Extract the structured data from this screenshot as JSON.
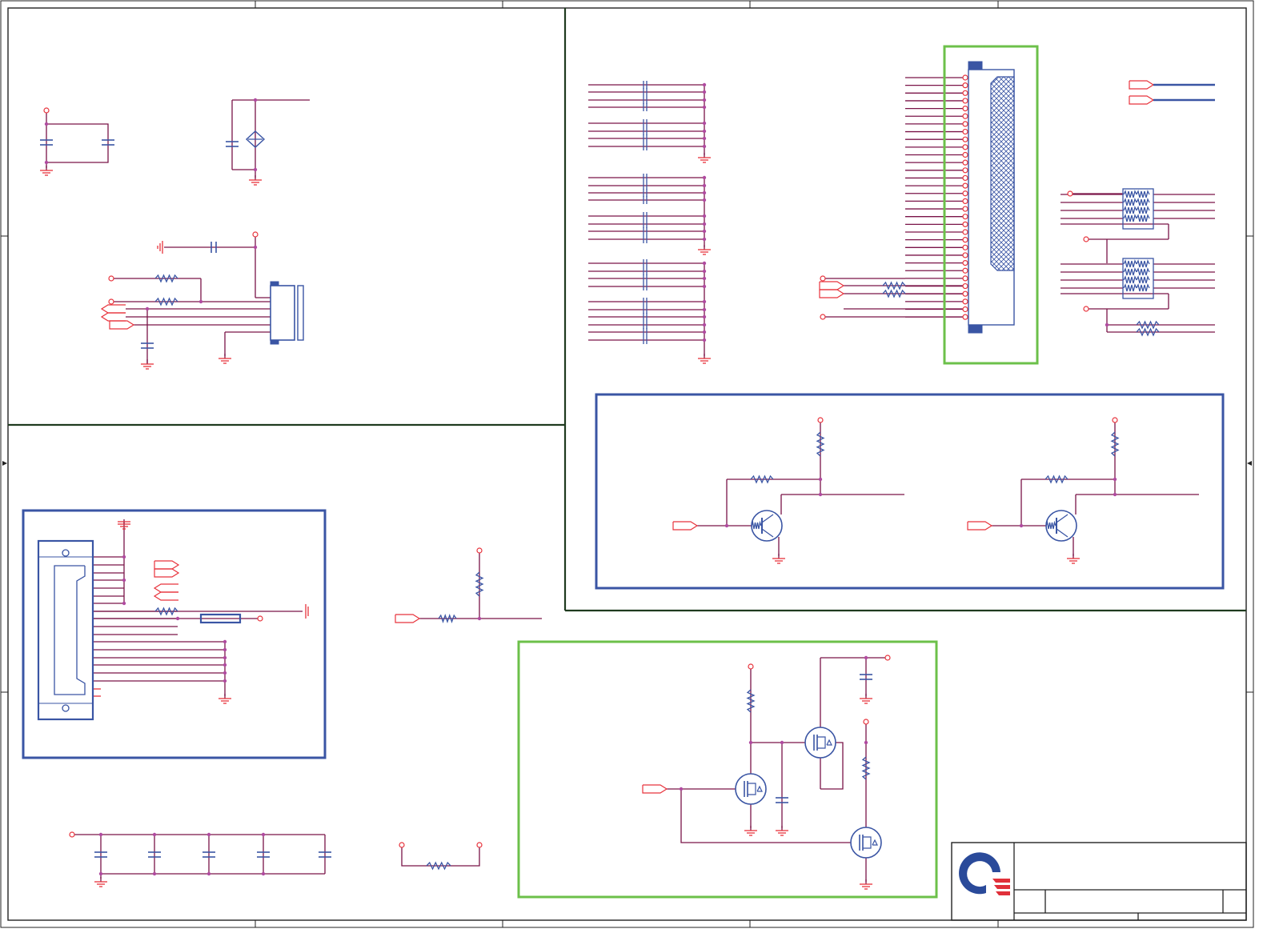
{
  "colors": {
    "wire": "#7a1448",
    "pin": "#e8333c",
    "component": "#3a55a4",
    "highlight_box": "#6cc04a",
    "section_border": "#1f3a1f",
    "frame": "#222222",
    "junction": "#b04aa0",
    "logo_blue": "#2a4a9a",
    "logo_red": "#e0303a"
  },
  "title_block": {
    "logo": "company-logo"
  }
}
